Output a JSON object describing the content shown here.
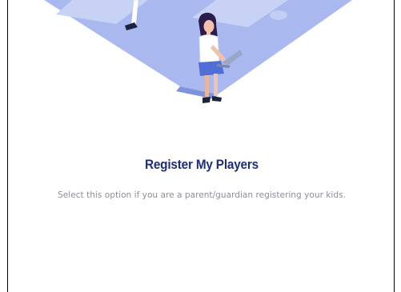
{
  "option_card": {
    "title": "Register My Players",
    "description": "Select this option if you are a parent/guardian registering your kids.",
    "colors": {
      "title": "#1d2e7a",
      "description": "#8b8f99",
      "field_blue": "#a8b8ee",
      "field_light": "#d5ddf6"
    }
  }
}
